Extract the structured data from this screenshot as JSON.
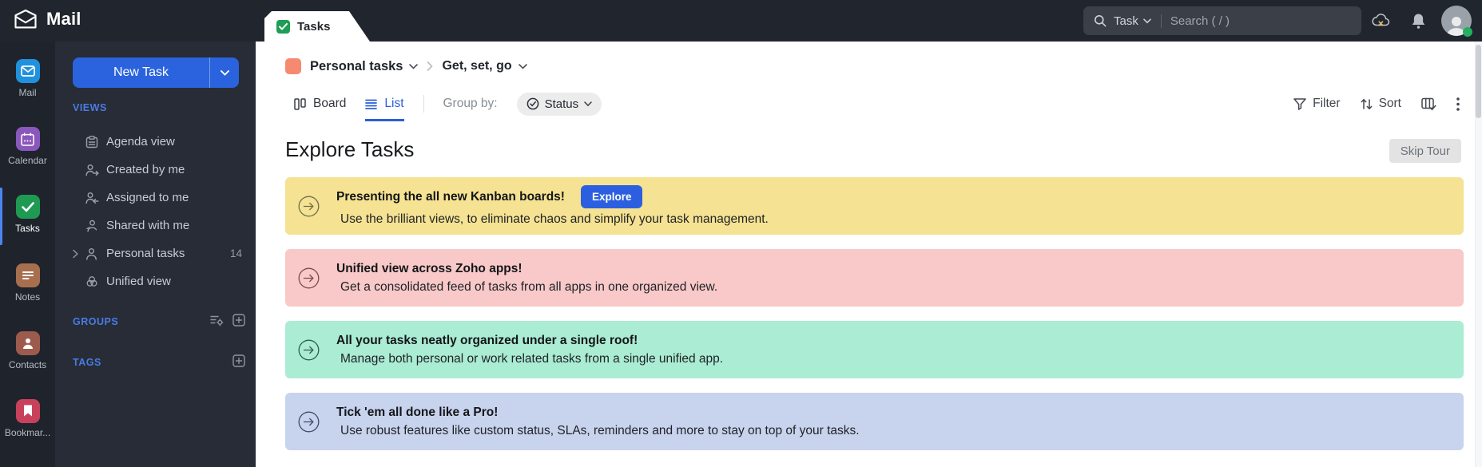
{
  "topbar": {
    "brand": "Mail",
    "tab_label": "Tasks",
    "search": {
      "scope": "Task",
      "placeholder": "Search ( / )"
    },
    "icons": {
      "search": "magnifier",
      "cloud": "cloud-offline-x",
      "notifications": "bell",
      "avatar": "person-silhouette-with-green-presence-dot"
    }
  },
  "rail": {
    "items": [
      {
        "label": "Mail",
        "icon": "mail-icon",
        "color": "#2091dd",
        "active": false
      },
      {
        "label": "Calendar",
        "icon": "calendar-icon",
        "color": "#8a57bc",
        "active": false
      },
      {
        "label": "Tasks",
        "icon": "tasks-icon",
        "color": "#1f9a53",
        "active": true
      },
      {
        "label": "Notes",
        "icon": "notes-icon",
        "color": "#a76f4e",
        "active": false
      },
      {
        "label": "Contacts",
        "icon": "contacts-icon",
        "color": "#9c5b4d",
        "active": false
      },
      {
        "label": "Bookmar...",
        "icon": "bookmark-icon",
        "color": "#c8415b",
        "active": false
      }
    ]
  },
  "sidebar": {
    "new_task_label": "New Task",
    "views": {
      "title": "VIEWS",
      "items": [
        {
          "label": "Agenda view",
          "icon": "agenda-icon"
        },
        {
          "label": "Created by me",
          "icon": "person-arrow-out-icon"
        },
        {
          "label": "Assigned to me",
          "icon": "person-arrow-in-icon"
        },
        {
          "label": "Shared with me",
          "icon": "person-share-icon"
        },
        {
          "label": "Personal tasks",
          "icon": "person-icon",
          "count": "14",
          "expandable": true
        },
        {
          "label": "Unified view",
          "icon": "unified-circles-icon"
        }
      ]
    },
    "groups_title": "GROUPS",
    "tags_title": "TAGS"
  },
  "breadcrumb": {
    "list_color": "#f58a70",
    "list_name": "Personal tasks",
    "view_name": "Get, set, go"
  },
  "toolbar": {
    "board_label": "Board",
    "list_label": "List",
    "group_by_label": "Group by:",
    "group_by_value": "Status",
    "filter_label": "Filter",
    "sort_label": "Sort"
  },
  "content": {
    "title": "Explore Tasks",
    "skip_button_label": "Skip Tour",
    "banners": [
      {
        "title": "Presenting the all new Kanban boards!",
        "button_label": "Explore",
        "subtitle": "Use the brilliant views, to eliminate chaos and simplify your task management.",
        "bg": "#f5e292",
        "icon_color": "#6e6f4b"
      },
      {
        "title": "Unified view across Zoho apps!",
        "subtitle": "Get a consolidated feed of tasks from all apps in one organized view.",
        "bg": "#f8c9c8",
        "icon_color": "#7a4b4b"
      },
      {
        "title": "All your tasks neatly organized under a single roof!",
        "subtitle": "Manage both personal or work related tasks from a single unified app.",
        "bg": "#aaecd4",
        "icon_color": "#2f5d4d"
      },
      {
        "title": "Tick 'em all done like a Pro!",
        "subtitle": "Use robust features like custom status, SLAs, reminders and more to stay on top of your tasks.",
        "bg": "#c8d3ee",
        "icon_color": "#3f4a6e"
      }
    ]
  },
  "colors": {
    "topbar_bg": "#21262e",
    "rail_bg": "#1f242c",
    "sidebar_bg": "#272c36",
    "accent_blue": "#2b63de",
    "active_tab_blue": "#2b5fd9",
    "section_heading_blue": "#4a7be4",
    "tasks_green": "#1f9a53",
    "presence_green": "#23b060"
  }
}
